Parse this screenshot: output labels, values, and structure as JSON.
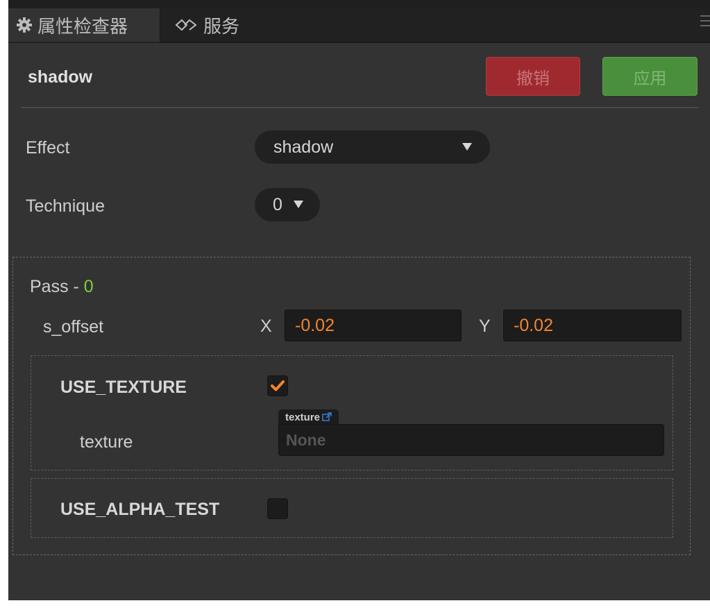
{
  "tabs": [
    {
      "label": "属性检查器",
      "icon": "gear-icon",
      "active": true
    },
    {
      "label": "服务",
      "icon": "service-icon",
      "active": false
    }
  ],
  "header": {
    "title": "shadow",
    "revert_label": "撤销",
    "apply_label": "应用"
  },
  "effect": {
    "label": "Effect",
    "value": "shadow"
  },
  "technique": {
    "label": "Technique",
    "value": "0"
  },
  "pass": {
    "label": "Pass - ",
    "index": "0",
    "s_offset": {
      "label": "s_offset",
      "x_label": "X",
      "x": "-0.02",
      "y_label": "Y",
      "y": "-0.02"
    },
    "use_texture": {
      "label": "USE_TEXTURE",
      "checked": true
    },
    "texture": {
      "label": "texture",
      "tag": "texture",
      "value": "None"
    },
    "use_alpha_test": {
      "label": "USE_ALPHA_TEST",
      "checked": false
    }
  },
  "colors": {
    "accent_number": "#f2852e",
    "pass_index": "#7cd13a",
    "revert": "#9e2a30",
    "apply": "#4a8f3c",
    "checkbox_check": "#f2852e"
  }
}
